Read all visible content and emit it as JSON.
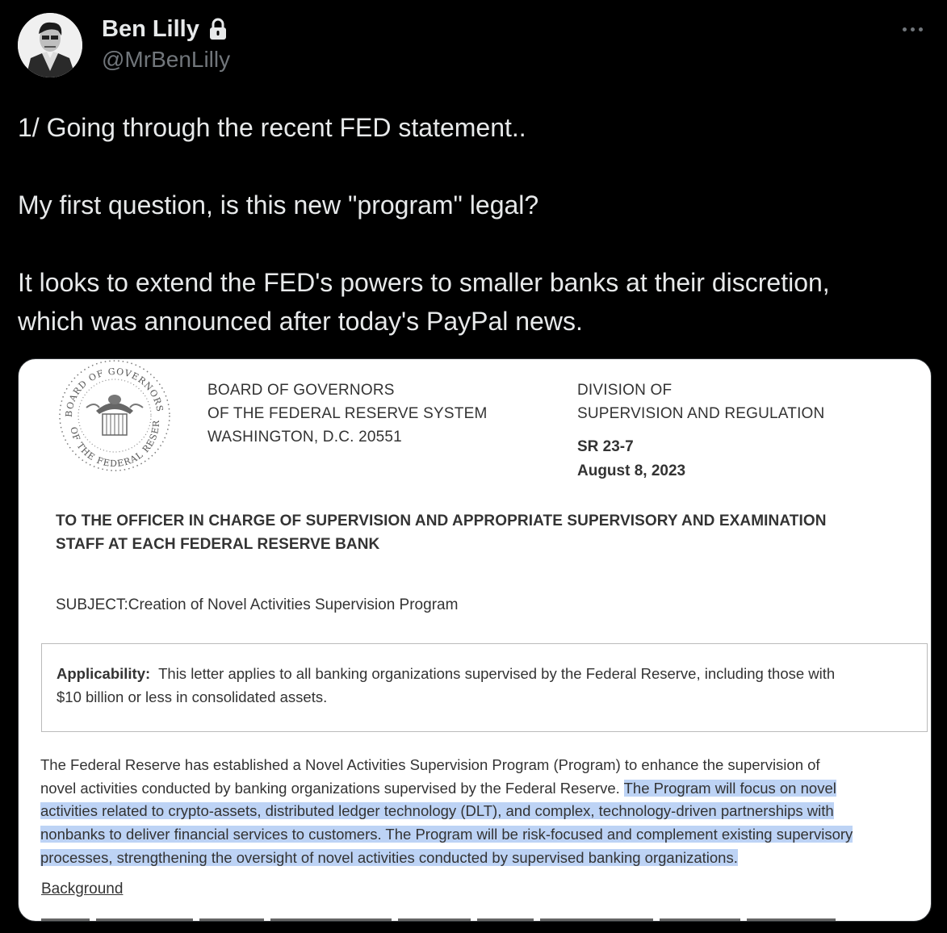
{
  "author": {
    "display_name": "Ben Lilly",
    "handle": "@MrBenLilly"
  },
  "tweet": {
    "lines": [
      "1/ Going through the recent FED statement..",
      "My first question, is this new \"program\" legal?",
      "It looks to extend the FED's powers to smaller banks at their discretion,",
      "which was announced after today's PayPal news."
    ]
  },
  "document": {
    "seal_text_top": "BOARD OF GOVERNORS",
    "seal_text_bottom": "OF THE FEDERAL RESERVE SYSTEM",
    "letterhead_left": [
      "BOARD OF GOVERNORS",
      "OF THE FEDERAL RESERVE SYSTEM",
      "WASHINGTON, D.C. 20551"
    ],
    "letterhead_right": [
      "DIVISION OF",
      "SUPERVISION AND REGULATION"
    ],
    "sr_number": "SR 23-7",
    "date": "August 8, 2023",
    "to_line_1": "TO THE OFFICER IN CHARGE OF SUPERVISION AND APPROPRIATE SUPERVISORY AND EXAMINATION",
    "to_line_2": "STAFF AT EACH FEDERAL RESERVE BANK",
    "subject": "SUBJECT:Creation of Novel Activities Supervision Program",
    "applicability_label": "Applicability:",
    "applicability_text_1": "This letter applies to all banking organizations supervised by the Federal Reserve, including those with",
    "applicability_text_2": "$10 billion or less in consolidated assets.",
    "body_1": "The Federal Reserve has established a Novel Activities Supervision Program (Program) to enhance the supervision of",
    "body_2_plain": "novel activities conducted by banking organizations supervised by the Federal Reserve.",
    "body_2_hl": "The Program will focus on novel",
    "body_3_hl": "activities related to crypto-assets, distributed ledger technology (DLT), and complex, technology-driven partnerships with",
    "body_4_hl": "nonbanks to deliver financial services to customers. The Program will be risk-focused and complement existing supervisory",
    "body_5_hl": "processes, strengthening the oversight of novel activities conducted by supervised banking organizations.",
    "background_link": "Background"
  },
  "colors": {
    "background": "#000000",
    "text": "#e7e9ea",
    "muted": "#71767b",
    "highlight": "#bdd3f5"
  }
}
